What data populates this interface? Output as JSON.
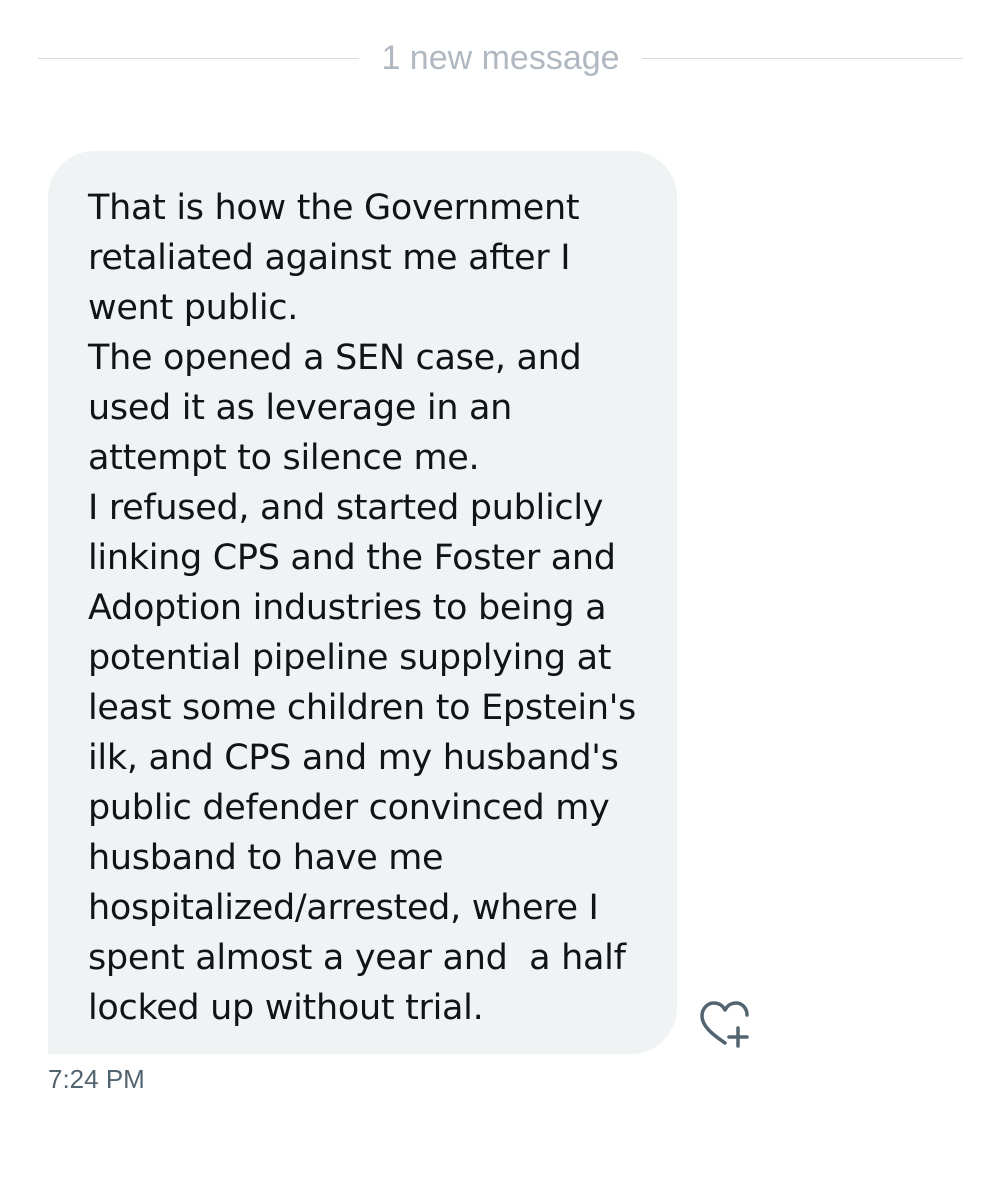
{
  "divider": {
    "label": "1 new message"
  },
  "message": {
    "lines": [
      "That is how the Government",
      "retaliated against me after I",
      "went public.",
      "The opened a SEN case, and",
      "used it as leverage in an",
      "attempt to silence me.",
      "I refused, and started publicly",
      "linking CPS and the Foster and",
      "Adoption industries to being a",
      "potential pipeline supplying at",
      "least some children to Epstein's",
      "ilk, and CPS and my husband's",
      "public defender convinced my",
      "husband to have me",
      "hospitalized/arrested, where I",
      "spent almost a year and  a half",
      "locked up without trial."
    ],
    "timestamp": "7:24 PM",
    "react_icon": "heart-plus-icon"
  },
  "colors": {
    "bubble": "#eff3f4",
    "text": "#0f1419",
    "muted": "#536471",
    "divider": "#d6dbe0"
  }
}
